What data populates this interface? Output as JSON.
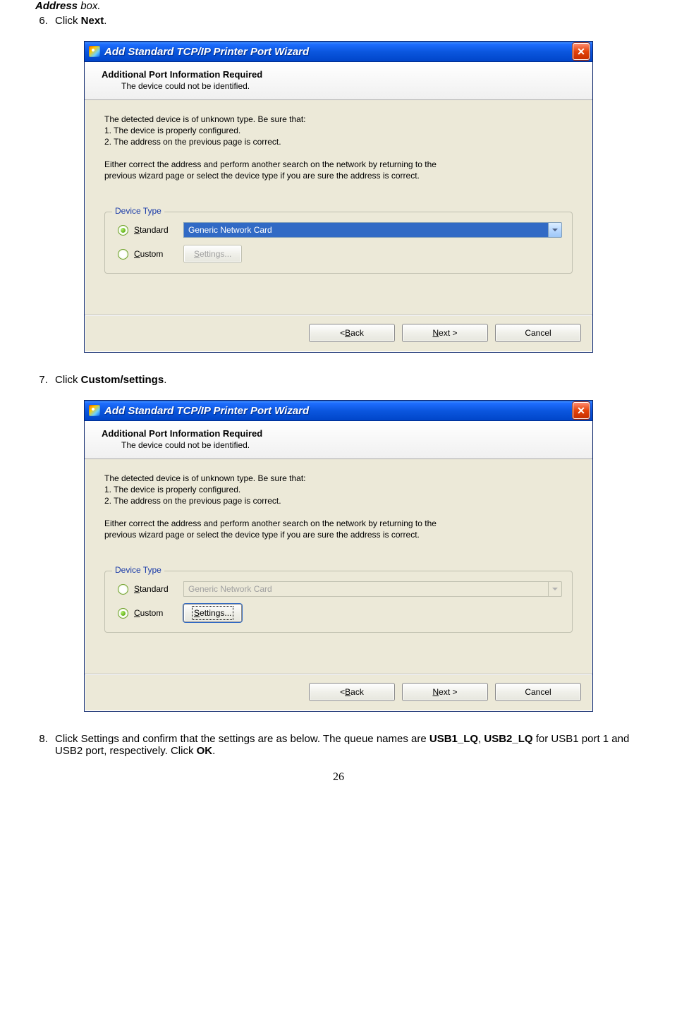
{
  "intro": {
    "bold_italic": "Address",
    "italic": " box."
  },
  "steps": {
    "s6_a": "Click ",
    "s6_b": "Next",
    "s6_c": ".",
    "s7_a": "Click ",
    "s7_b": "Custom/settings",
    "s7_c": ".",
    "s8_a": "Click Settings and confirm that the settings are as below. The queue names are ",
    "s8_b": "USB1_LQ",
    "s8_c": ", ",
    "s8_d": "USB2_LQ",
    "s8_e": " for USB1 port 1 and USB2 port, respectively. Click ",
    "s8_f": "OK",
    "s8_g": "."
  },
  "dialog": {
    "title": "Add Standard TCP/IP Printer Port Wizard",
    "header_title": "Additional Port Information Required",
    "header_sub": "The device could not be identified.",
    "body": {
      "l1": "The detected device is of unknown type.  Be sure that:",
      "l2": "1.  The device is properly configured.",
      "l3": "2.  The address on the previous page is correct.",
      "e1": "Either correct the address and perform another search on the network by returning to the",
      "e2": "previous wizard page or select the device type if you are sure the address is correct."
    },
    "group": {
      "legend": "Device Type",
      "standard": "tandard",
      "standard_u": "S",
      "custom": "ustom",
      "custom_u": "C",
      "combo_value": "Generic Network Card",
      "settings": "ettings...",
      "settings_u": "S"
    },
    "footer": {
      "back": "ack",
      "back_u": "B",
      "next": "ext >",
      "next_u": "N",
      "cancel": "Cancel"
    }
  },
  "page_number": "26"
}
